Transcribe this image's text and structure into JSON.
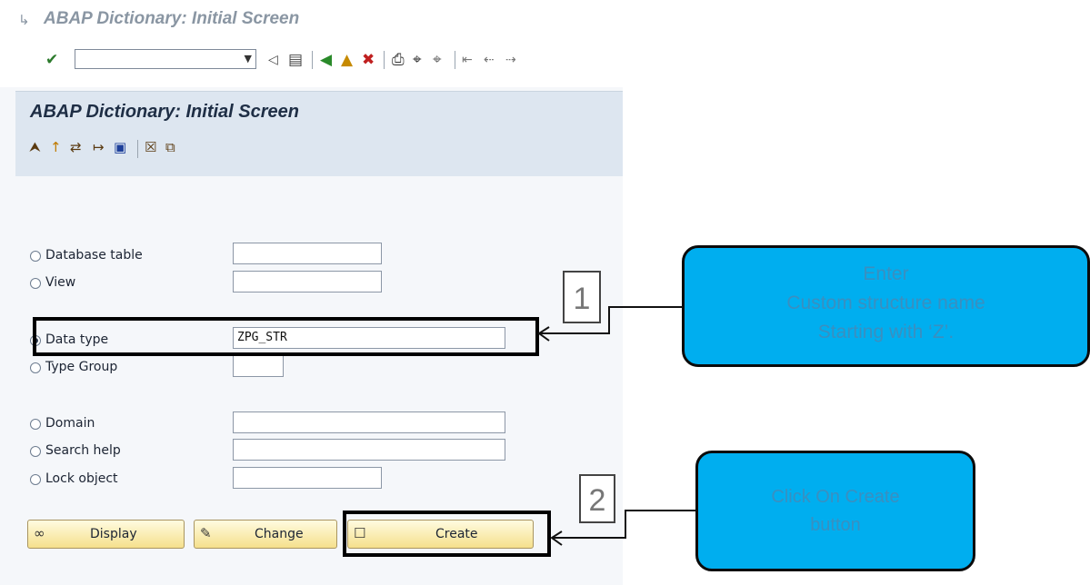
{
  "window": {
    "title": "ABAP Dictionary: Initial Screen"
  },
  "toolbar": {
    "command_field_value": "",
    "icons": [
      "enter-check-icon",
      "back-triangle-icon",
      "save-icon",
      "back-icon",
      "exit-icon",
      "cancel-icon",
      "print-icon",
      "find-icon",
      "find-next-icon",
      "first-page-icon",
      "previous-page-icon",
      "next-page-icon"
    ]
  },
  "screen": {
    "title": "ABAP Dictionary: Initial Screen",
    "app_icons": [
      "other-object-icon",
      "where-used-icon",
      "transport-icon",
      "activate-icon",
      "info-icon",
      "delete-icon",
      "copy-icon"
    ]
  },
  "form": {
    "options": [
      {
        "label": "Database table",
        "value": "",
        "selected": false
      },
      {
        "label": "View",
        "value": "",
        "selected": false
      },
      {
        "label": "Data type",
        "value": "ZPG_STR",
        "selected": true
      },
      {
        "label": "Type Group",
        "value": "",
        "selected": false
      },
      {
        "label": "Domain",
        "value": "",
        "selected": false
      },
      {
        "label": "Search help",
        "value": "",
        "selected": false
      },
      {
        "label": "Lock object",
        "value": "",
        "selected": false
      }
    ]
  },
  "buttons": {
    "display": "Display",
    "change": "Change",
    "create": "Create"
  },
  "annotations": {
    "step1": {
      "number": "1",
      "callout_lines": [
        "Enter",
        "Custom structure name",
        "Starting with ‘Z’."
      ]
    },
    "step2": {
      "number": "2",
      "callout_lines": [
        "Click On Create",
        "button"
      ]
    },
    "colors": {
      "callout_fill": "#00aeef",
      "callout_text": "#3a8fc0",
      "highlight": "#000000"
    }
  }
}
